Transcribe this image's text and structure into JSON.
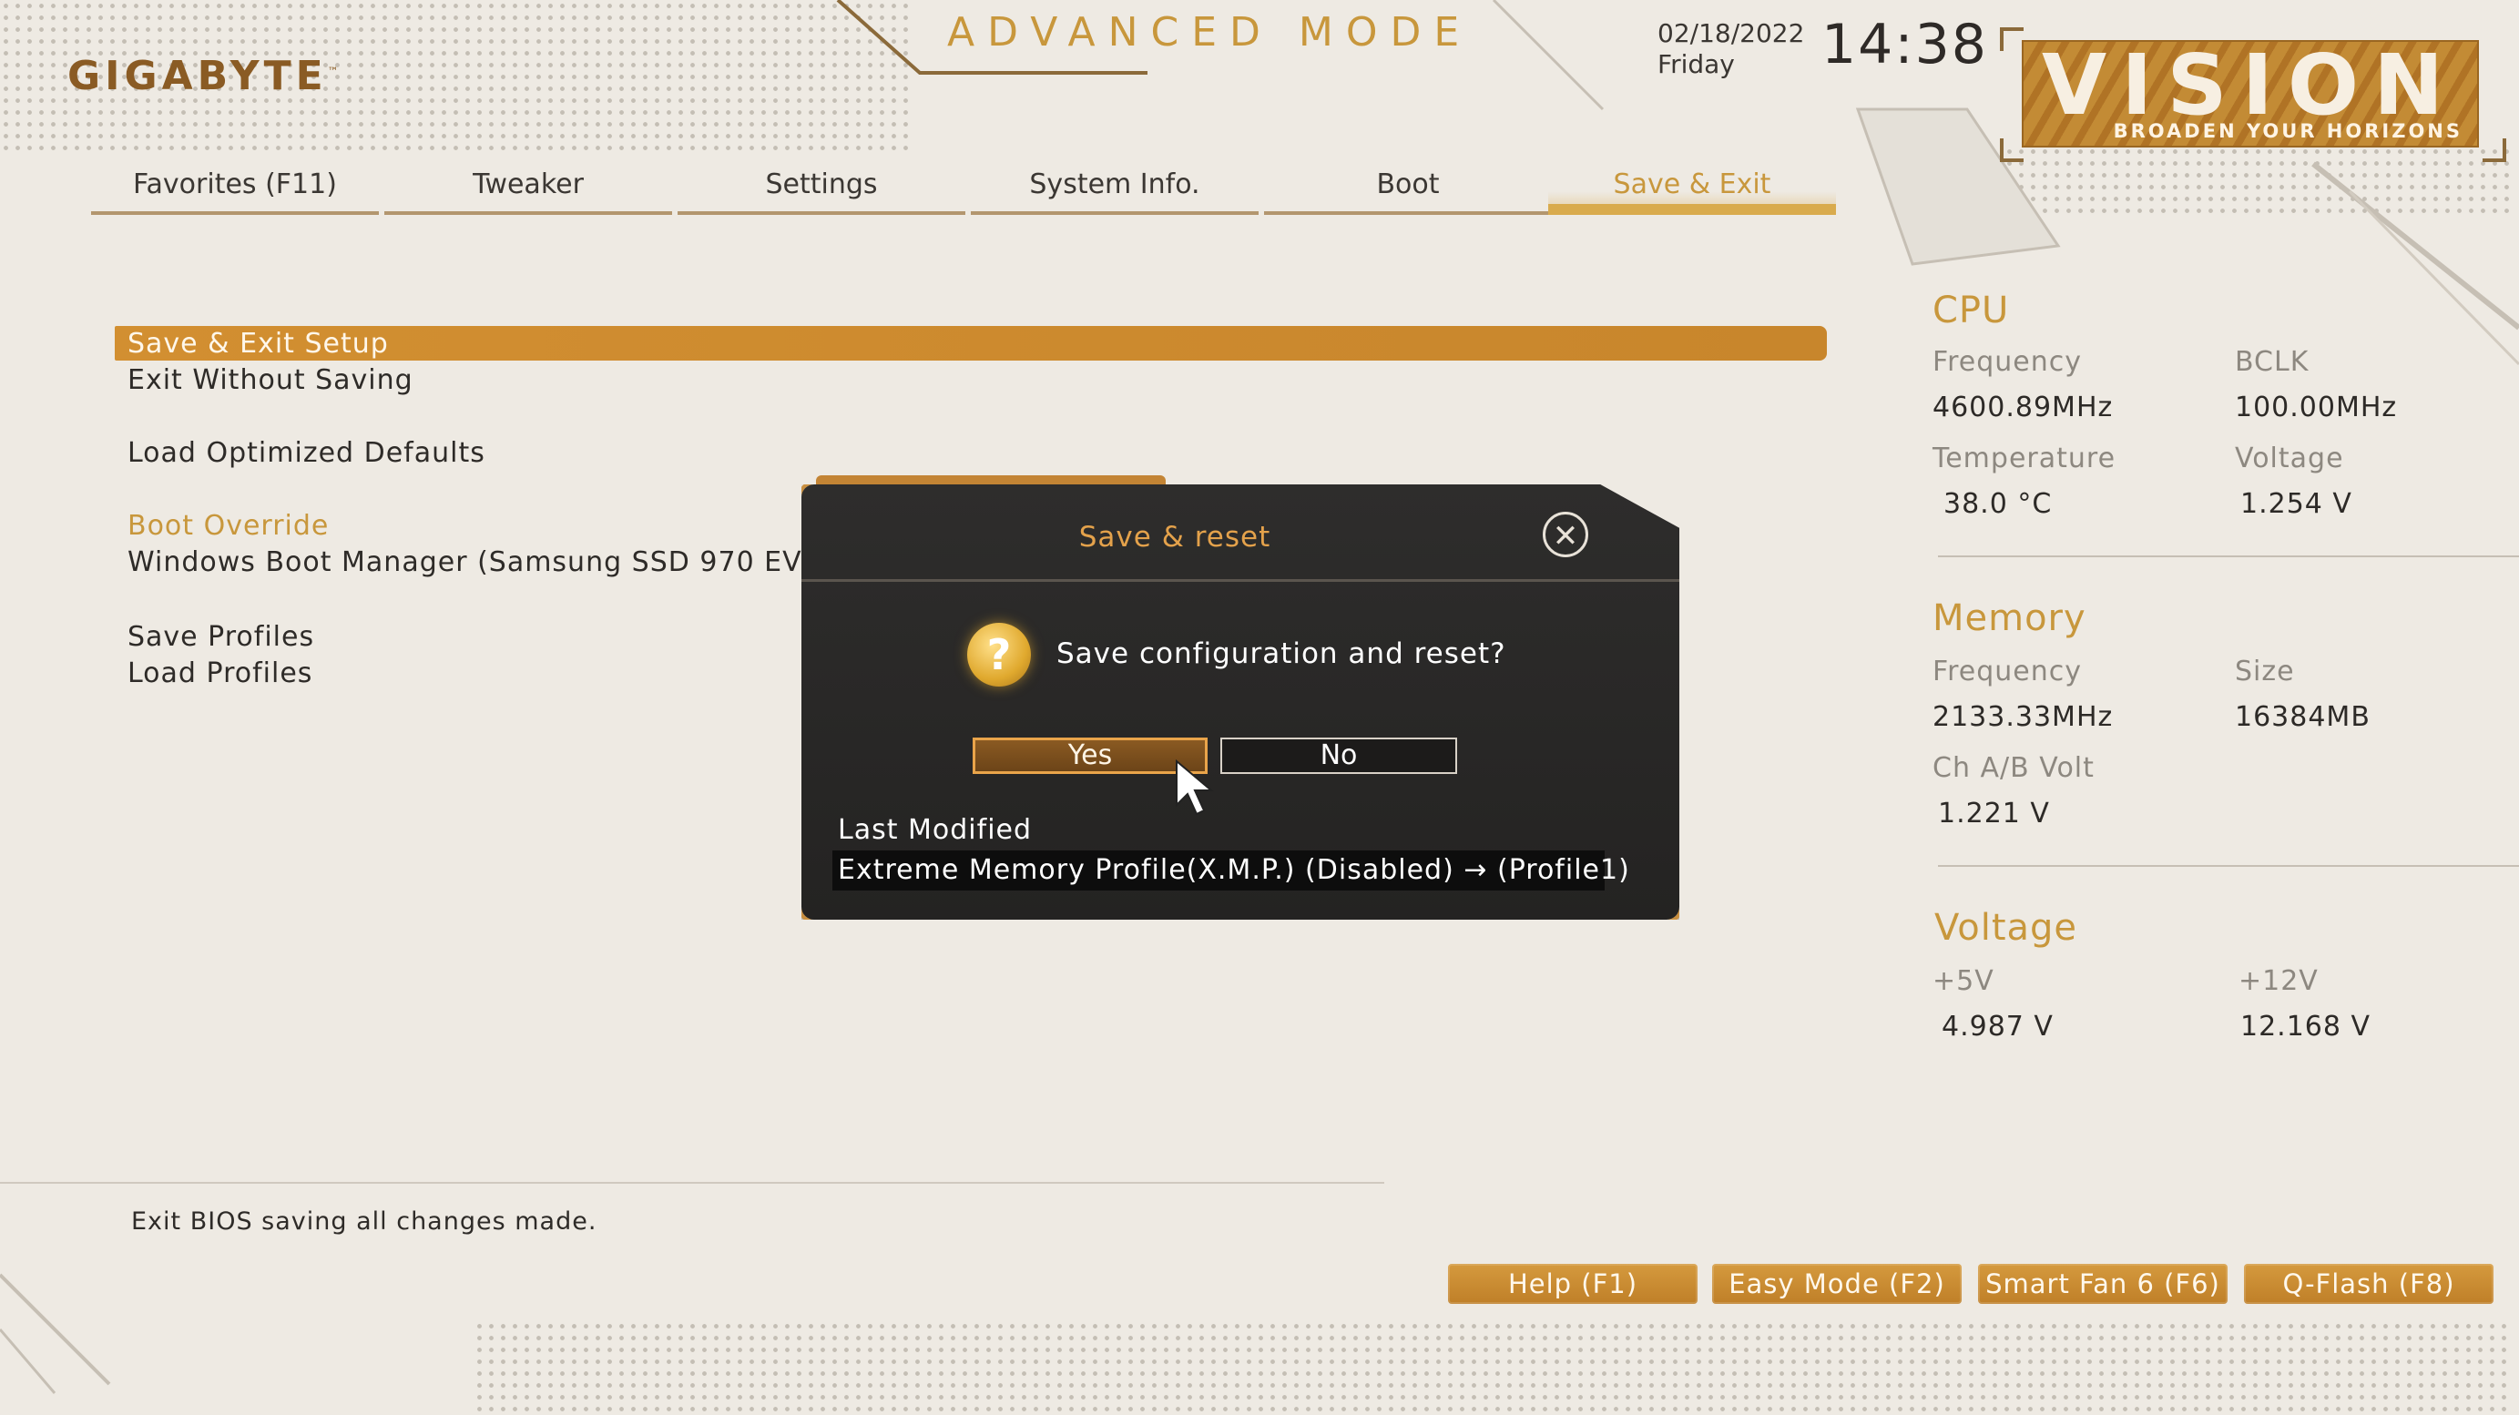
{
  "brand": {
    "logo": "GIGABYTE",
    "tm": "™"
  },
  "header": {
    "mode_title": "ADVANCED MODE",
    "date": "02/18/2022",
    "day": "Friday",
    "time": "14:38",
    "vision_title": "VISION",
    "vision_tagline": "BROADEN YOUR HORIZONS"
  },
  "tabs": [
    {
      "label": "Favorites (F11)"
    },
    {
      "label": "Tweaker"
    },
    {
      "label": "Settings"
    },
    {
      "label": "System Info."
    },
    {
      "label": "Boot"
    },
    {
      "label": "Save & Exit",
      "active": true
    }
  ],
  "menu": {
    "save_exit_setup": "Save & Exit Setup",
    "exit_without_saving": "Exit Without Saving",
    "load_optimized_defaults": "Load Optimized Defaults",
    "boot_override": "Boot Override",
    "windows_boot_manager": "Windows Boot Manager (Samsung SSD 970 EV",
    "save_profiles": "Save Profiles",
    "load_profiles": "Load Profiles"
  },
  "help_text": "Exit BIOS saving all changes made.",
  "sidebar": {
    "cpu": {
      "heading": "CPU",
      "frequency_label": "Frequency",
      "frequency_value": "4600.89MHz",
      "bclk_label": "BCLK",
      "bclk_value": "100.00MHz",
      "temperature_label": "Temperature",
      "temperature_value": "38.0 °C",
      "voltage_label": "Voltage",
      "voltage_value": "1.254 V"
    },
    "memory": {
      "heading": "Memory",
      "frequency_label": "Frequency",
      "frequency_value": "2133.33MHz",
      "size_label": "Size",
      "size_value": "16384MB",
      "chab_label": "Ch A/B Volt",
      "chab_value": "1.221 V"
    },
    "voltage": {
      "heading": "Voltage",
      "v5_label": "+5V",
      "v5_value": "4.987 V",
      "v12_label": "+12V",
      "v12_value": "12.168 V"
    }
  },
  "footer_buttons": [
    {
      "label": "Help (F1)"
    },
    {
      "label": "Easy Mode (F2)"
    },
    {
      "label": "Smart Fan 6 (F6)"
    },
    {
      "label": "Q-Flash (F8)"
    }
  ],
  "dialog": {
    "title": "Save & reset",
    "close_glyph": "✕",
    "question_glyph": "?",
    "question": "Save configuration and reset?",
    "yes_label": "Yes",
    "no_label": "No",
    "last_modified_label": "Last Modified",
    "last_modified_item": "Extreme Memory Profile(X.M.P.) (Disabled) → (Profile1)"
  },
  "colors": {
    "accent": "#c8973c",
    "accent_dark": "#c38434",
    "background": "#eeeae3",
    "dialog_bg": "#2a2928"
  }
}
